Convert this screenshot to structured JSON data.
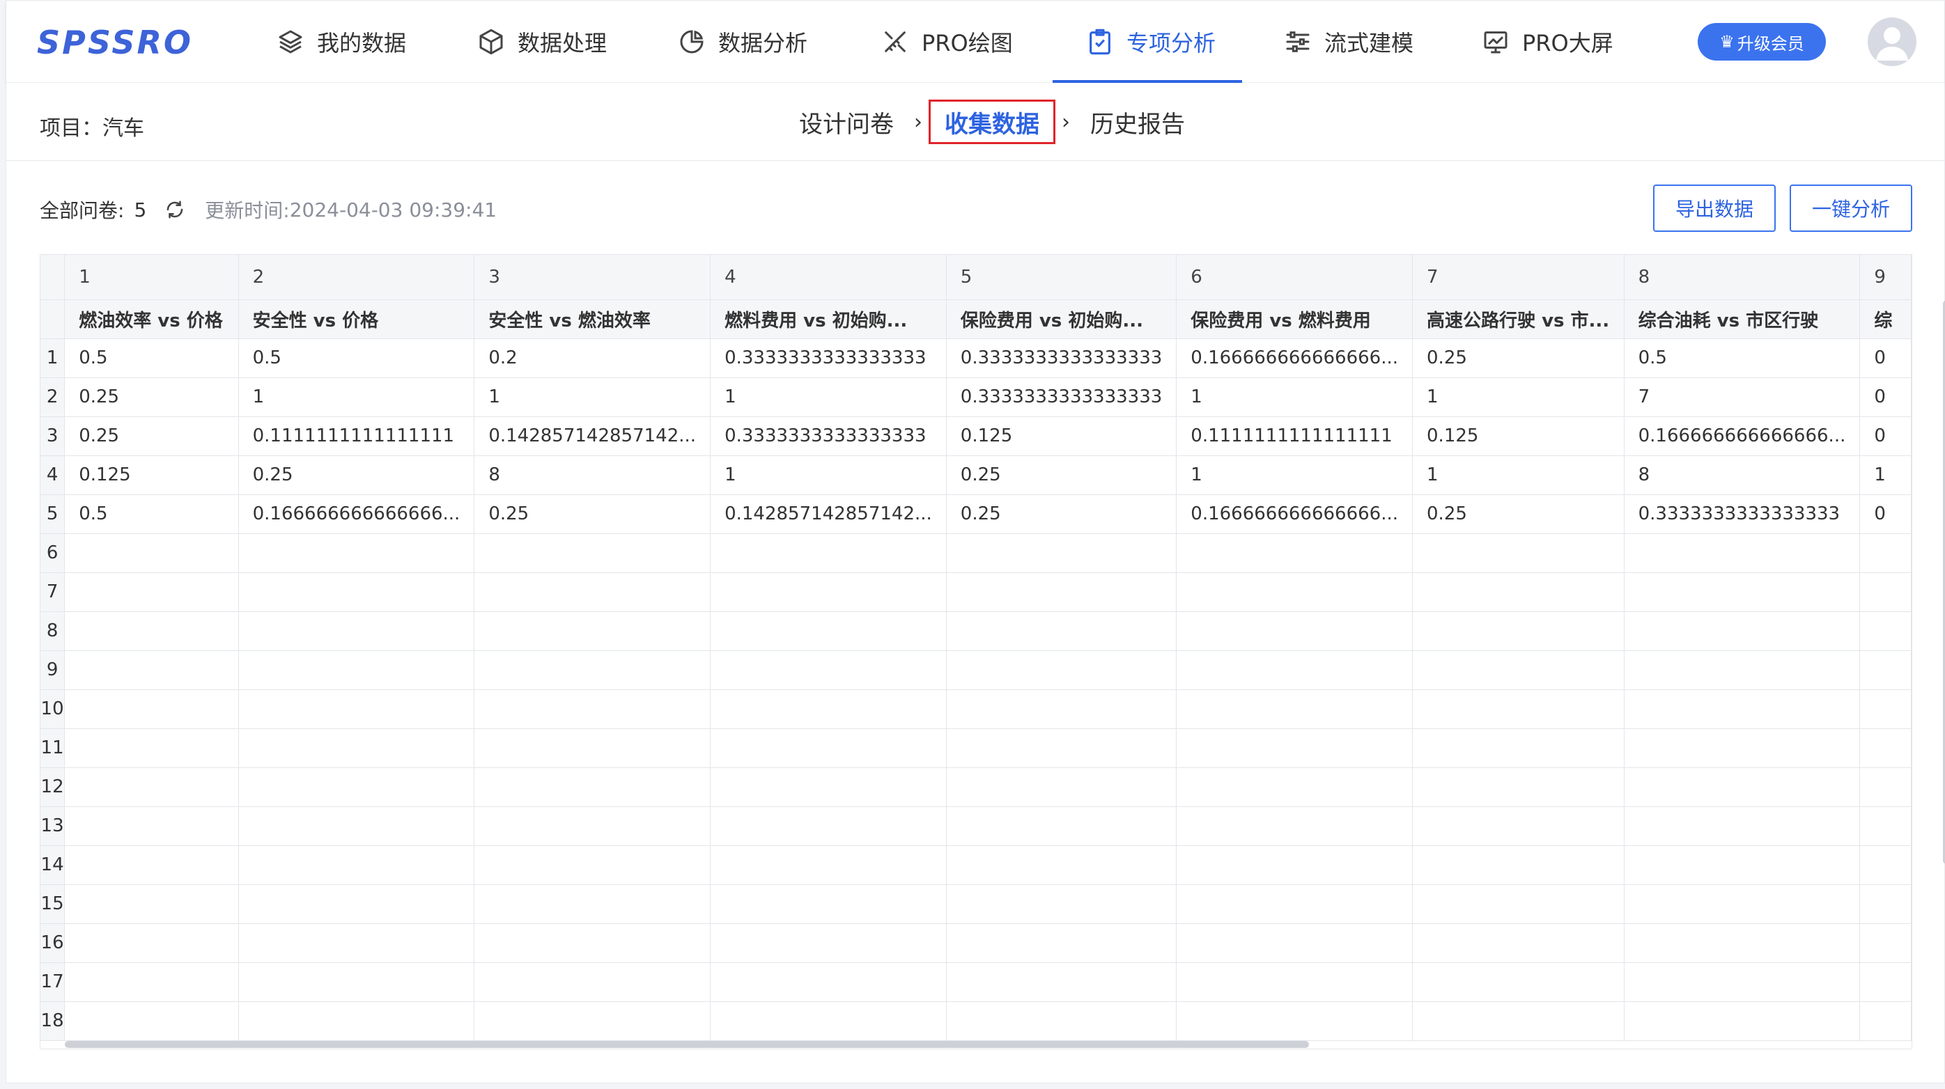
{
  "app": {
    "logo": "SPSSRO"
  },
  "nav": {
    "items": [
      {
        "label": "我的数据",
        "icon": "layers-icon"
      },
      {
        "label": "数据处理",
        "icon": "cube-icon"
      },
      {
        "label": "数据分析",
        "icon": "pie-chart-icon"
      },
      {
        "label": "PRO绘图",
        "icon": "drawing-tools-icon"
      },
      {
        "label": "专项分析",
        "icon": "clipboard-check-icon",
        "active": true
      },
      {
        "label": "流式建模",
        "icon": "sliders-icon"
      },
      {
        "label": "PRO大屏",
        "icon": "monitor-chart-icon"
      }
    ],
    "vip_label": "升级会员",
    "accent": "#2d63e0"
  },
  "project": {
    "label": "项目：汽车"
  },
  "steps": [
    {
      "label": "设计问卷"
    },
    {
      "label": "收集数据",
      "active": true
    },
    {
      "label": "历史报告"
    }
  ],
  "summary": {
    "total_label": "全部问卷:",
    "total_count": "5",
    "updated_label": "更新时间:",
    "updated_value": "2024-04-03 09:39:41"
  },
  "buttons": {
    "export": "导出数据",
    "analyze": "一键分析"
  },
  "table": {
    "column_numbers": [
      "1",
      "2",
      "3",
      "4",
      "5",
      "6",
      "7",
      "8",
      "9"
    ],
    "headers": [
      "燃油效率 vs 价格",
      "安全性 vs 价格",
      "安全性 vs 燃油效率",
      "燃料费用 vs 初始购...",
      "保险费用 vs 初始购...",
      "保险费用 vs 燃料费用",
      "高速公路行驶 vs 市...",
      "综合油耗 vs 市区行驶",
      "综"
    ],
    "rows": [
      [
        "0.5",
        "0.5",
        "0.2",
        "0.3333333333333333",
        "0.3333333333333333",
        "0.166666666666666...",
        "0.25",
        "0.5",
        "0"
      ],
      [
        "0.25",
        "1",
        "1",
        "1",
        "0.3333333333333333",
        "1",
        "1",
        "7",
        "0"
      ],
      [
        "0.25",
        "0.1111111111111111",
        "0.142857142857142...",
        "0.3333333333333333",
        "0.125",
        "0.1111111111111111",
        "0.125",
        "0.166666666666666...",
        "0"
      ],
      [
        "0.125",
        "0.25",
        "8",
        "1",
        "0.25",
        "1",
        "1",
        "8",
        "1"
      ],
      [
        "0.5",
        "0.166666666666666...",
        "0.25",
        "0.142857142857142...",
        "0.25",
        "0.166666666666666...",
        "0.25",
        "0.3333333333333333",
        "0"
      ]
    ],
    "row_numbers": [
      "1",
      "2",
      "3",
      "4",
      "5",
      "6",
      "7",
      "8",
      "9",
      "10",
      "11",
      "12",
      "13",
      "14",
      "15",
      "16",
      "17",
      "18"
    ]
  }
}
